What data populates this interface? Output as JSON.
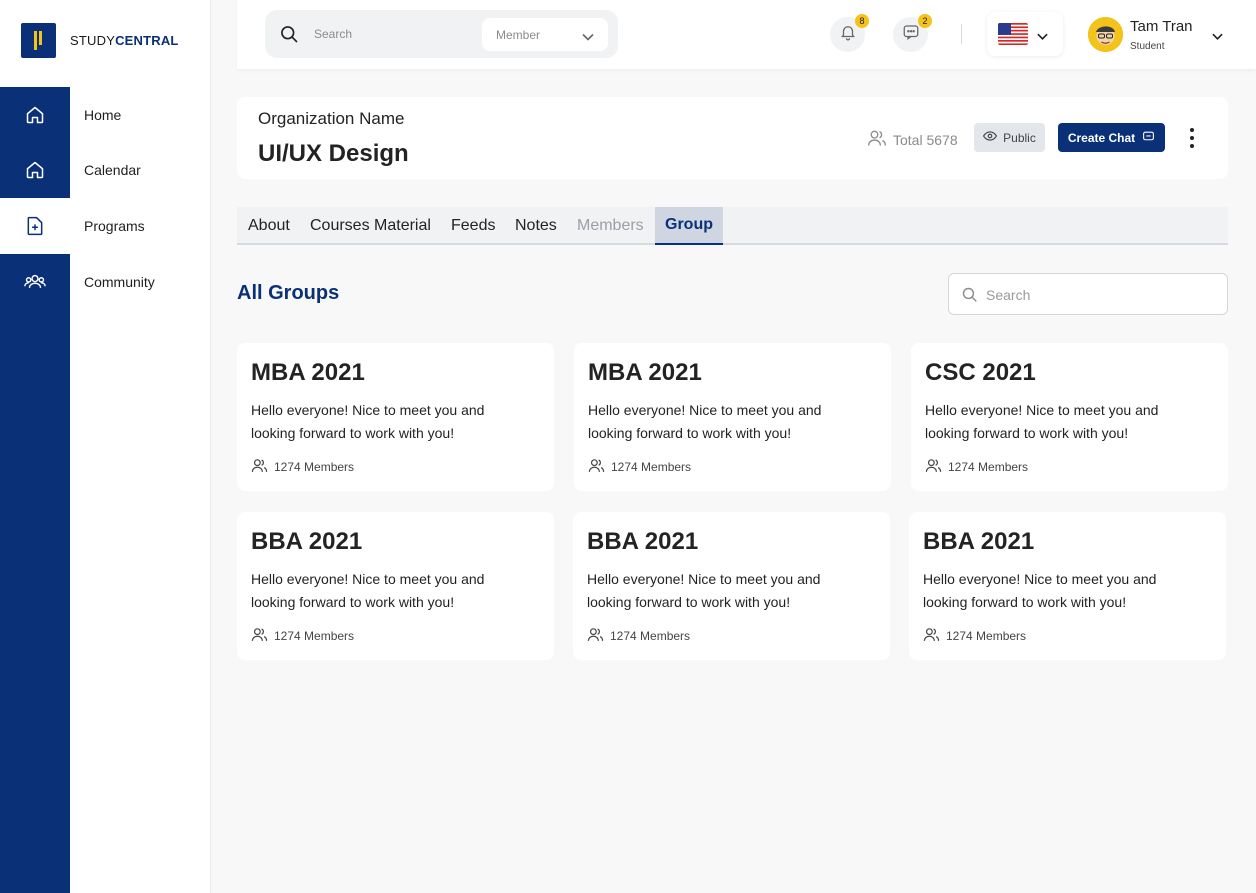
{
  "brand": {
    "prefix": "STUDY",
    "suffix": "CENTRAL"
  },
  "sidebar": {
    "items": [
      {
        "label": "Home",
        "icon": "home-icon"
      },
      {
        "label": "Calendar",
        "icon": "home-icon"
      },
      {
        "label": "Programs",
        "icon": "document-plus-icon"
      },
      {
        "label": "Community",
        "icon": "users-icon"
      }
    ]
  },
  "topbar": {
    "search_placeholder": "Search",
    "filter_value": "Member",
    "notifications_count": "8",
    "messages_count": "2",
    "language": "flag-us",
    "user": {
      "name": "Tam Tran",
      "role": "Student"
    }
  },
  "org": {
    "label": "Organization Name",
    "title": "UI/UX Design",
    "total": "Total 5678",
    "visibility": "Public",
    "create_chat": "Create Chat"
  },
  "tabs": [
    {
      "label": "About"
    },
    {
      "label": "Courses Material"
    },
    {
      "label": "Feeds"
    },
    {
      "label": "Notes"
    },
    {
      "label": "Members"
    },
    {
      "label": "Group"
    }
  ],
  "groups_section": {
    "title": "All Groups",
    "search_placeholder": "Search",
    "groups": [
      {
        "name": "MBA 2021",
        "description": "Hello everyone! Nice to meet you and looking forward to work with you!",
        "members": "1274 Members"
      },
      {
        "name": "MBA 2021",
        "description": "Hello everyone! Nice to meet you and looking forward to work with you!",
        "members": "1274 Members"
      },
      {
        "name": "CSC 2021",
        "description": "Hello everyone! Nice to meet you and looking forward to work with you!",
        "members": "1274 Members"
      },
      {
        "name": "BBA 2021",
        "description": "Hello everyone! Nice to meet you and looking forward to work with you!",
        "members": "1274 Members"
      },
      {
        "name": "BBA 2021",
        "description": "Hello everyone! Nice to meet you and looking forward to work with you!",
        "members": "1274 Members"
      },
      {
        "name": "BBA 2021",
        "description": "Hello everyone! Nice to meet you and looking forward to work with you!",
        "members": "1274 Members"
      }
    ]
  },
  "colors": {
    "primary": "#0a3078",
    "accent": "#f3c21b",
    "background": "#f8f8f8"
  }
}
